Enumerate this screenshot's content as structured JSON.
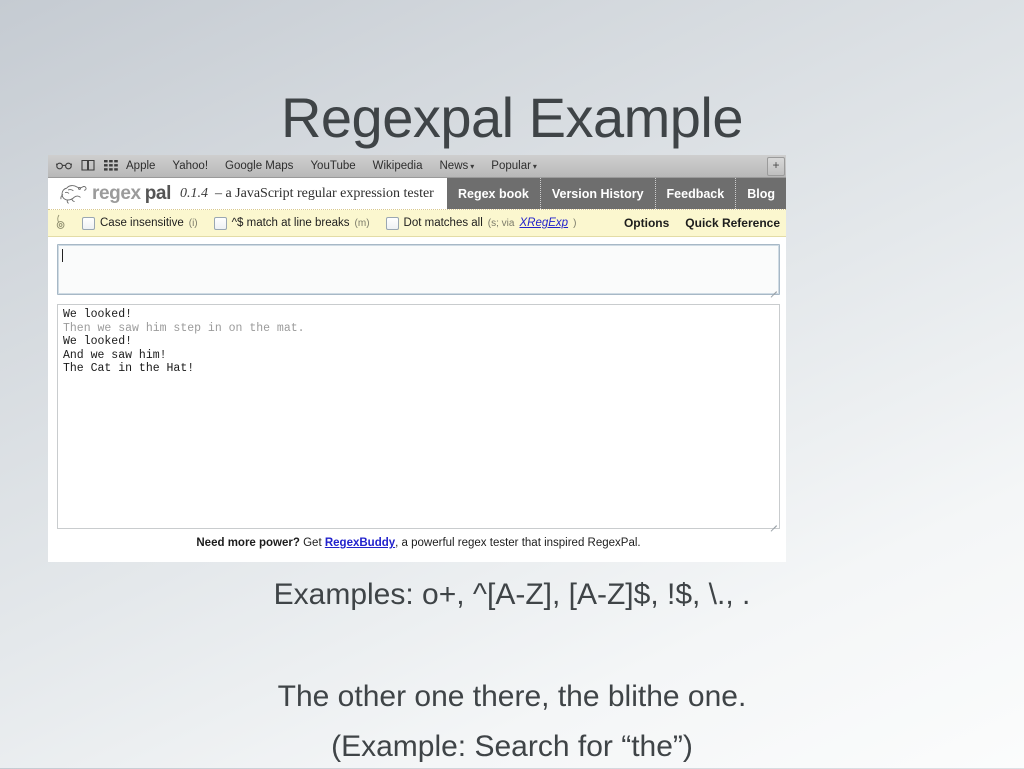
{
  "slide": {
    "title": "Regexpal Example",
    "examples_line": "Examples: o+, ^[A-Z], [A-Z]$, !$, \\., .",
    "body_line_1": "The other one there, the blithe one.",
    "body_line_2": "(Example: Search for “the”)"
  },
  "browser": {
    "bookmarks_icons": [
      "reading-glasses-icon",
      "open-book-icon",
      "grid-icon"
    ],
    "bookmarks": [
      {
        "label": "Apple",
        "caret": ""
      },
      {
        "label": "Yahoo!",
        "caret": ""
      },
      {
        "label": "Google Maps",
        "caret": ""
      },
      {
        "label": "YouTube",
        "caret": ""
      },
      {
        "label": "Wikipedia",
        "caret": ""
      },
      {
        "label": "News",
        "caret": "▾"
      },
      {
        "label": "Popular",
        "caret": "▾"
      }
    ],
    "new_tab_label": "+"
  },
  "page": {
    "brand": {
      "name_part1": "regex",
      "name_part2": "pal",
      "version": "0.1.4",
      "tagline": "– a JavaScript regular expression tester"
    },
    "nav": [
      {
        "label": "Regex book"
      },
      {
        "label": "Version History"
      },
      {
        "label": "Feedback"
      },
      {
        "label": "Blog"
      }
    ],
    "options": {
      "checkboxes": [
        {
          "label": "Case insensitive",
          "flag": "(i)",
          "checked": false
        },
        {
          "label": "^$ match at line breaks",
          "flag": "(m)",
          "checked": false
        },
        {
          "label": "Dot matches all",
          "flag": "(s; via ",
          "link": "XRegExp",
          "flag_end": ")",
          "checked": false
        }
      ],
      "options_label": "Options",
      "quick_reference_label": "Quick Reference"
    },
    "regex_input": {
      "value": "",
      "placeholder": ""
    },
    "subject_text": {
      "line1": "We looked!",
      "line2": "Then we saw him step in on the mat.",
      "line3": "We looked!",
      "line4": "And we saw him!",
      "line5": "The Cat in the Hat!"
    },
    "footer": {
      "bold": "Need more power?",
      "mid": " Get ",
      "link": "RegexBuddy",
      "rest": ", a powerful regex tester that inspired RegexPal."
    }
  },
  "colors": {
    "slide_text": "#3f4447",
    "nav_bar": "#6e6e6e",
    "options_bar": "#fbf7cf",
    "link": "#2222cc",
    "brand_gray": "#9b9b9b",
    "brand_dark": "#555555"
  }
}
